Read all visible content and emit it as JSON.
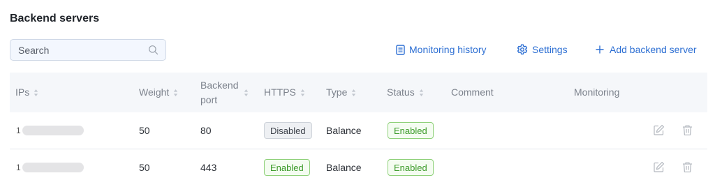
{
  "page": {
    "title": "Backend servers"
  },
  "search": {
    "placeholder": "Search",
    "value": ""
  },
  "actions": {
    "monitoring_history": "Monitoring history",
    "settings": "Settings",
    "add_backend_server": "Add backend server"
  },
  "table": {
    "headers": {
      "ips": "IPs",
      "weight": "Weight",
      "backend_port": "Backend port",
      "https": "HTTPS",
      "type": "Type",
      "status": "Status",
      "comment": "Comment",
      "monitoring": "Monitoring"
    },
    "rows": [
      {
        "ip_visible": "1",
        "weight": "50",
        "port": "80",
        "https": "Disabled",
        "type": "Balance",
        "status": "Enabled",
        "comment": ""
      },
      {
        "ip_visible": "1",
        "weight": "50",
        "port": "443",
        "https": "Enabled",
        "type": "Balance",
        "status": "Enabled",
        "comment": ""
      }
    ]
  },
  "colors": {
    "accent": "#2d6fd3",
    "enabled_text": "#3a9a28",
    "enabled_border": "#8fd17a",
    "disabled_text": "#3f444c",
    "header_bg": "#f5f7fa"
  },
  "icons": {
    "search": "search-icon",
    "monitoring_history": "document-icon",
    "settings": "gear-icon",
    "add": "plus-icon",
    "edit": "edit-icon",
    "delete": "trash-icon",
    "sort": "sort-icon"
  }
}
